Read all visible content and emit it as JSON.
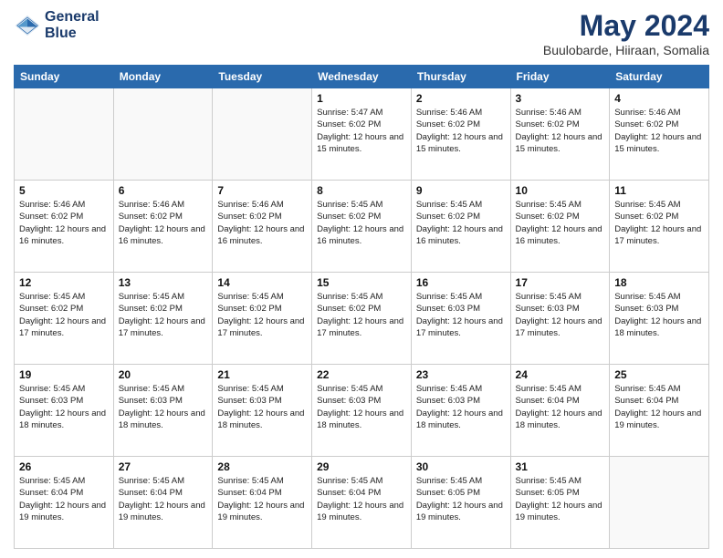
{
  "logo": {
    "line1": "General",
    "line2": "Blue"
  },
  "title": "May 2024",
  "location": "Buulobarde, Hiiraan, Somalia",
  "headers": [
    "Sunday",
    "Monday",
    "Tuesday",
    "Wednesday",
    "Thursday",
    "Friday",
    "Saturday"
  ],
  "weeks": [
    [
      {
        "day": "",
        "info": ""
      },
      {
        "day": "",
        "info": ""
      },
      {
        "day": "",
        "info": ""
      },
      {
        "day": "1",
        "info": "Sunrise: 5:47 AM\nSunset: 6:02 PM\nDaylight: 12 hours\nand 15 minutes."
      },
      {
        "day": "2",
        "info": "Sunrise: 5:46 AM\nSunset: 6:02 PM\nDaylight: 12 hours\nand 15 minutes."
      },
      {
        "day": "3",
        "info": "Sunrise: 5:46 AM\nSunset: 6:02 PM\nDaylight: 12 hours\nand 15 minutes."
      },
      {
        "day": "4",
        "info": "Sunrise: 5:46 AM\nSunset: 6:02 PM\nDaylight: 12 hours\nand 15 minutes."
      }
    ],
    [
      {
        "day": "5",
        "info": "Sunrise: 5:46 AM\nSunset: 6:02 PM\nDaylight: 12 hours\nand 16 minutes."
      },
      {
        "day": "6",
        "info": "Sunrise: 5:46 AM\nSunset: 6:02 PM\nDaylight: 12 hours\nand 16 minutes."
      },
      {
        "day": "7",
        "info": "Sunrise: 5:46 AM\nSunset: 6:02 PM\nDaylight: 12 hours\nand 16 minutes."
      },
      {
        "day": "8",
        "info": "Sunrise: 5:45 AM\nSunset: 6:02 PM\nDaylight: 12 hours\nand 16 minutes."
      },
      {
        "day": "9",
        "info": "Sunrise: 5:45 AM\nSunset: 6:02 PM\nDaylight: 12 hours\nand 16 minutes."
      },
      {
        "day": "10",
        "info": "Sunrise: 5:45 AM\nSunset: 6:02 PM\nDaylight: 12 hours\nand 16 minutes."
      },
      {
        "day": "11",
        "info": "Sunrise: 5:45 AM\nSunset: 6:02 PM\nDaylight: 12 hours\nand 17 minutes."
      }
    ],
    [
      {
        "day": "12",
        "info": "Sunrise: 5:45 AM\nSunset: 6:02 PM\nDaylight: 12 hours\nand 17 minutes."
      },
      {
        "day": "13",
        "info": "Sunrise: 5:45 AM\nSunset: 6:02 PM\nDaylight: 12 hours\nand 17 minutes."
      },
      {
        "day": "14",
        "info": "Sunrise: 5:45 AM\nSunset: 6:02 PM\nDaylight: 12 hours\nand 17 minutes."
      },
      {
        "day": "15",
        "info": "Sunrise: 5:45 AM\nSunset: 6:02 PM\nDaylight: 12 hours\nand 17 minutes."
      },
      {
        "day": "16",
        "info": "Sunrise: 5:45 AM\nSunset: 6:03 PM\nDaylight: 12 hours\nand 17 minutes."
      },
      {
        "day": "17",
        "info": "Sunrise: 5:45 AM\nSunset: 6:03 PM\nDaylight: 12 hours\nand 17 minutes."
      },
      {
        "day": "18",
        "info": "Sunrise: 5:45 AM\nSunset: 6:03 PM\nDaylight: 12 hours\nand 18 minutes."
      }
    ],
    [
      {
        "day": "19",
        "info": "Sunrise: 5:45 AM\nSunset: 6:03 PM\nDaylight: 12 hours\nand 18 minutes."
      },
      {
        "day": "20",
        "info": "Sunrise: 5:45 AM\nSunset: 6:03 PM\nDaylight: 12 hours\nand 18 minutes."
      },
      {
        "day": "21",
        "info": "Sunrise: 5:45 AM\nSunset: 6:03 PM\nDaylight: 12 hours\nand 18 minutes."
      },
      {
        "day": "22",
        "info": "Sunrise: 5:45 AM\nSunset: 6:03 PM\nDaylight: 12 hours\nand 18 minutes."
      },
      {
        "day": "23",
        "info": "Sunrise: 5:45 AM\nSunset: 6:03 PM\nDaylight: 12 hours\nand 18 minutes."
      },
      {
        "day": "24",
        "info": "Sunrise: 5:45 AM\nSunset: 6:04 PM\nDaylight: 12 hours\nand 18 minutes."
      },
      {
        "day": "25",
        "info": "Sunrise: 5:45 AM\nSunset: 6:04 PM\nDaylight: 12 hours\nand 19 minutes."
      }
    ],
    [
      {
        "day": "26",
        "info": "Sunrise: 5:45 AM\nSunset: 6:04 PM\nDaylight: 12 hours\nand 19 minutes."
      },
      {
        "day": "27",
        "info": "Sunrise: 5:45 AM\nSunset: 6:04 PM\nDaylight: 12 hours\nand 19 minutes."
      },
      {
        "day": "28",
        "info": "Sunrise: 5:45 AM\nSunset: 6:04 PM\nDaylight: 12 hours\nand 19 minutes."
      },
      {
        "day": "29",
        "info": "Sunrise: 5:45 AM\nSunset: 6:04 PM\nDaylight: 12 hours\nand 19 minutes."
      },
      {
        "day": "30",
        "info": "Sunrise: 5:45 AM\nSunset: 6:05 PM\nDaylight: 12 hours\nand 19 minutes."
      },
      {
        "day": "31",
        "info": "Sunrise: 5:45 AM\nSunset: 6:05 PM\nDaylight: 12 hours\nand 19 minutes."
      },
      {
        "day": "",
        "info": ""
      }
    ]
  ]
}
